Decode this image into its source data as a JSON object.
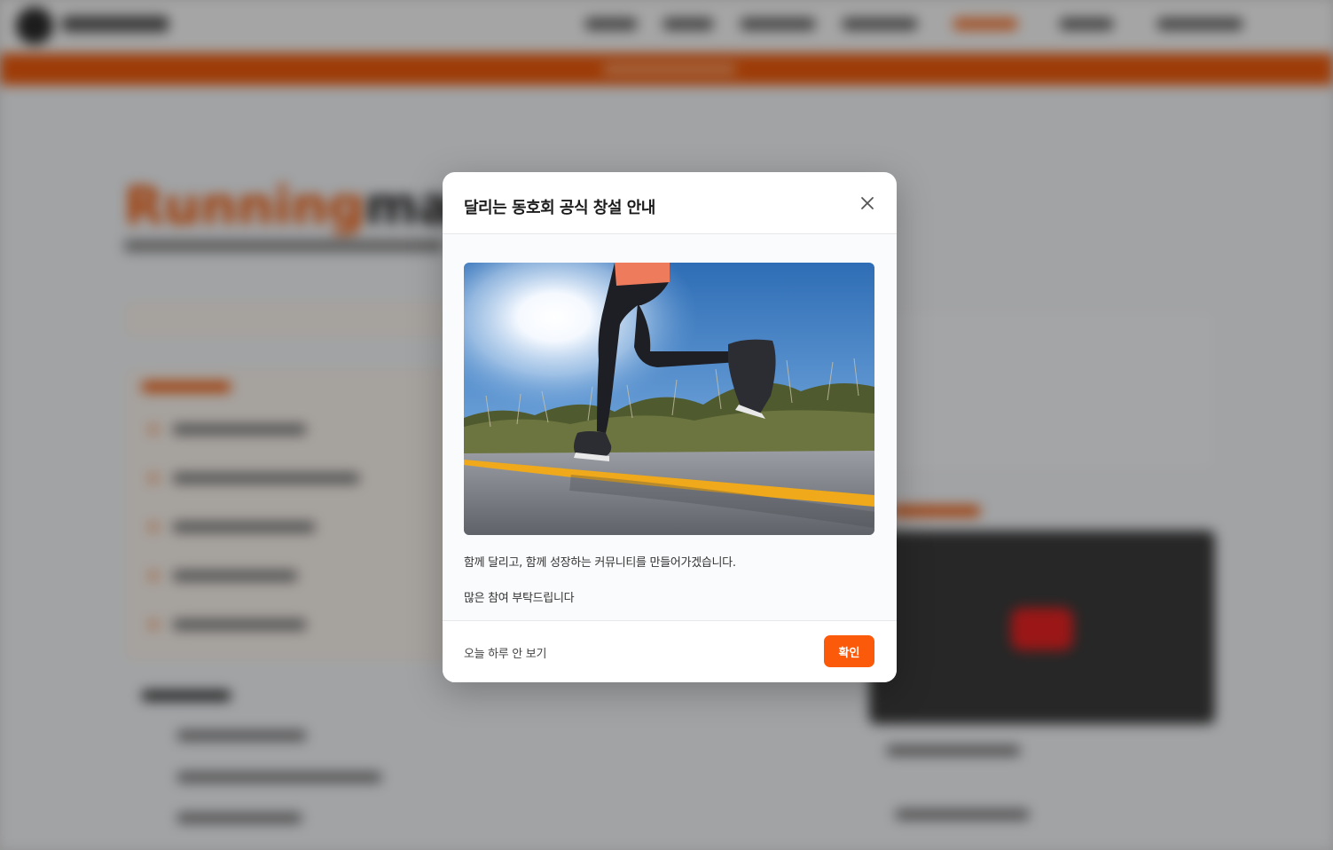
{
  "modal": {
    "title": "달리는 동호회 공식 창설 안내",
    "image": {
      "icon": "runner-photo",
      "alt": ""
    },
    "message_line_1": "함께 달리고, 함께 성장하는 커뮤니티를 만들어가겠습니다.",
    "message_line_2": "많은 참여 부탁드립니다",
    "skip_label": "오늘 하루 안 보기",
    "confirm_label": "확인",
    "close_icon": "close-icon"
  },
  "background": {
    "hero_title_accent": "Running",
    "hero_title_rest": "mate"
  },
  "colors": {
    "accent": "#fa5a0a",
    "banner": "#e8590c",
    "overlay": "rgba(0,0,0,0.32)"
  }
}
